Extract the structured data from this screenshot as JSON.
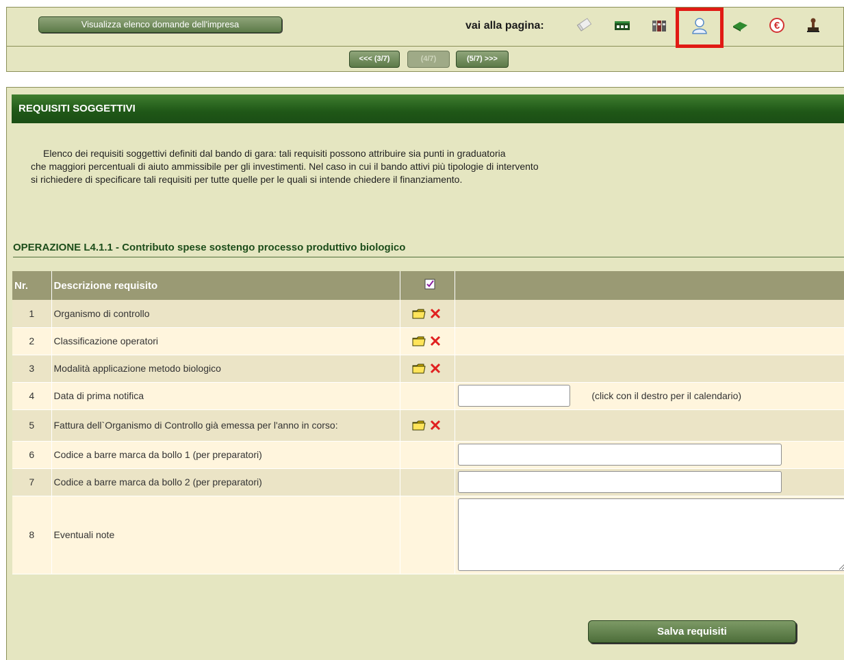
{
  "topbar": {
    "elenco_button": "Visualizza elenco domande dell'impresa",
    "vai_label": "vai alla pagina:",
    "nav_icons": [
      "documents-icon",
      "registry-icon",
      "folders-icon",
      "user-icon",
      "book-icon",
      "euro-icon",
      "stamp-icon"
    ],
    "active_icon": "user-icon",
    "pager": {
      "prev": "<<< (3/7)",
      "current": "(4/7)",
      "next": "(5/7) >>>"
    }
  },
  "section": {
    "title": "REQUISITI SOGGETTIVI",
    "intro_lines": [
      "Elenco dei requisiti soggettivi definiti dal bando di gara: tali requisiti possono attribuire sia punti in graduatoria",
      "che maggiori percentuali di aiuto ammissibile per gli investimenti. Nel caso in cui il bando attivi più tipologie di intervento",
      "si richiedere di specificare tali requisiti per tutte quelle per le quali si intende chiedere il finanziamento."
    ],
    "operation_title": "OPERAZIONE L4.1.1 - Contributo spese sostengo processo produttivo biologico"
  },
  "table": {
    "headers": {
      "nr": "Nr.",
      "descrizione": "Descrizione requisito",
      "check_icon": "checkbox-checked-icon"
    },
    "rows": [
      {
        "nr": "1",
        "descrizione": "Organismo di controllo",
        "type": "actions"
      },
      {
        "nr": "2",
        "descrizione": "Classificazione operatori",
        "type": "actions"
      },
      {
        "nr": "3",
        "descrizione": "Modalità applicazione metodo biologico",
        "type": "actions"
      },
      {
        "nr": "4",
        "descrizione": "Data di prima notifica",
        "type": "date",
        "value": "",
        "hint": "(click con il destro per il calendario)"
      },
      {
        "nr": "5",
        "descrizione": "Fattura dell`Organismo di Controllo già emessa per l'anno in corso:",
        "type": "actions"
      },
      {
        "nr": "6",
        "descrizione": "Codice a barre marca da bollo 1 (per preparatori)",
        "type": "text",
        "value": ""
      },
      {
        "nr": "7",
        "descrizione": "Codice a barre marca da bollo 2 (per preparatori)",
        "type": "text",
        "value": ""
      },
      {
        "nr": "8",
        "descrizione": "Eventuali note",
        "type": "textarea",
        "value": ""
      }
    ]
  },
  "save_button": "Salva requisiti",
  "colors": {
    "panel_bg": "#e5e6c1",
    "header_green": "#1f5717",
    "button_green": "#5c7a48",
    "active_frame": "#e11a14",
    "delete_red": "#e02020"
  }
}
